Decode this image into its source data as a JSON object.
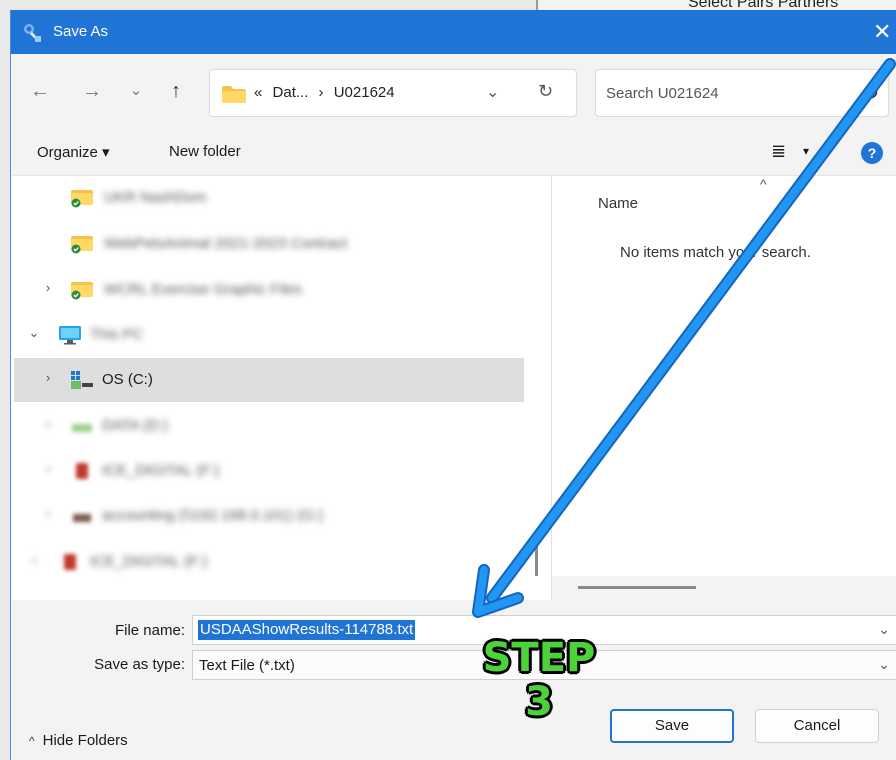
{
  "background_window": {
    "text": "Select Pairs Partners"
  },
  "dialog": {
    "title": "Save As",
    "close_glyph": "✕"
  },
  "nav": {
    "back_glyph": "←",
    "forward_glyph": "→",
    "recent_glyph": "⌄",
    "up_glyph": "↑",
    "breadcrumb": {
      "overflow": "«",
      "segment_1": "Dat...",
      "separator": "›",
      "segment_2": "U021624"
    },
    "dropdown_glyph": "⌄",
    "refresh_glyph": "↻",
    "search_placeholder": "Search U021624"
  },
  "toolbar": {
    "organize_label": "Organize ▾",
    "new_folder_label": "New folder",
    "view_glyph": "≣",
    "view_dropdown_glyph": "▾",
    "help_label": "?"
  },
  "tree": {
    "items": [
      {
        "label": "UKR NashDom",
        "chevron": "",
        "blurred": true
      },
      {
        "label": "WebPetsAnimal 2021-2023 Contract",
        "chevron": "",
        "blurred": true
      },
      {
        "label": "WCRL Exercise Graphic Files",
        "chevron": "›",
        "blurred": true
      },
      {
        "label": "This PC",
        "chevron": "⌄",
        "blurred": true
      },
      {
        "label": "OS (C:)",
        "chevron": "›",
        "blurred": false
      },
      {
        "label": "DATA (D:)",
        "chevron": "›",
        "blurred": true
      },
      {
        "label": "ICE_DIGITAL (F:)",
        "chevron": "›",
        "blurred": true
      },
      {
        "label": "accounting (\\\\192.168.0.101) (G:)",
        "chevron": "›",
        "blurred": true
      },
      {
        "label": "ICE_DIGITAL (F:)",
        "chevron": "›",
        "blurred": true
      }
    ]
  },
  "content": {
    "sort_caret": "^",
    "column_name": "Name",
    "empty_message": "No items match your search."
  },
  "fields": {
    "file_name_label": "File name:",
    "file_name_value": "USDAAShowResults-114788.txt",
    "save_type_label": "Save as type:",
    "save_type_value": "Text File (*.txt)",
    "dropdown_glyph": "⌄"
  },
  "footer": {
    "hide_folders_glyph": "^",
    "hide_folders_label": "Hide Folders",
    "save_label": "Save",
    "cancel_label": "Cancel"
  },
  "annotation": {
    "step_word": "STEP",
    "step_number": "3",
    "arrow_color": "#2196f3",
    "step_color": "#4cd33c"
  },
  "colors": {
    "accent": "#1f74d6",
    "selection": "#dedede",
    "chrome": "#f3f3f3"
  }
}
